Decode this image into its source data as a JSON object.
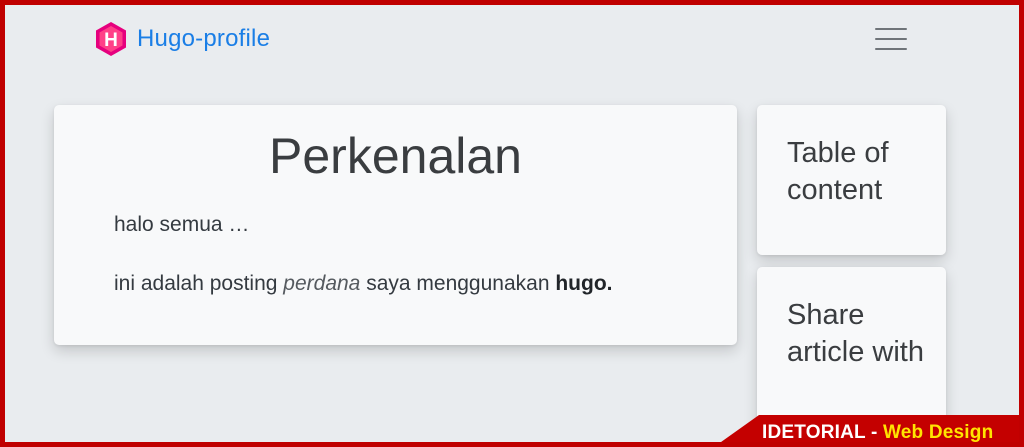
{
  "navbar": {
    "brand_letter": "H",
    "brand_name": "Hugo-profile",
    "menu_icon": "hamburger-menu-icon"
  },
  "post": {
    "title": "Perkenalan",
    "para1": "halo semua …",
    "para2_pre": "ini adalah posting ",
    "para2_em": "perdana",
    "para2_mid": " saya menggunakan ",
    "para2_strong": "hugo."
  },
  "sidebar": {
    "toc_title": "Table of content",
    "share_title": "Share article with"
  },
  "watermark": {
    "part1": "IDETORIAL - ",
    "part2": "Web Design"
  },
  "colors": {
    "frame_border": "#c00000",
    "brand_text": "#1a7ee6",
    "logo": "#e6007e",
    "watermark_bg": "#c40000",
    "watermark_accent": "#ffe400"
  }
}
